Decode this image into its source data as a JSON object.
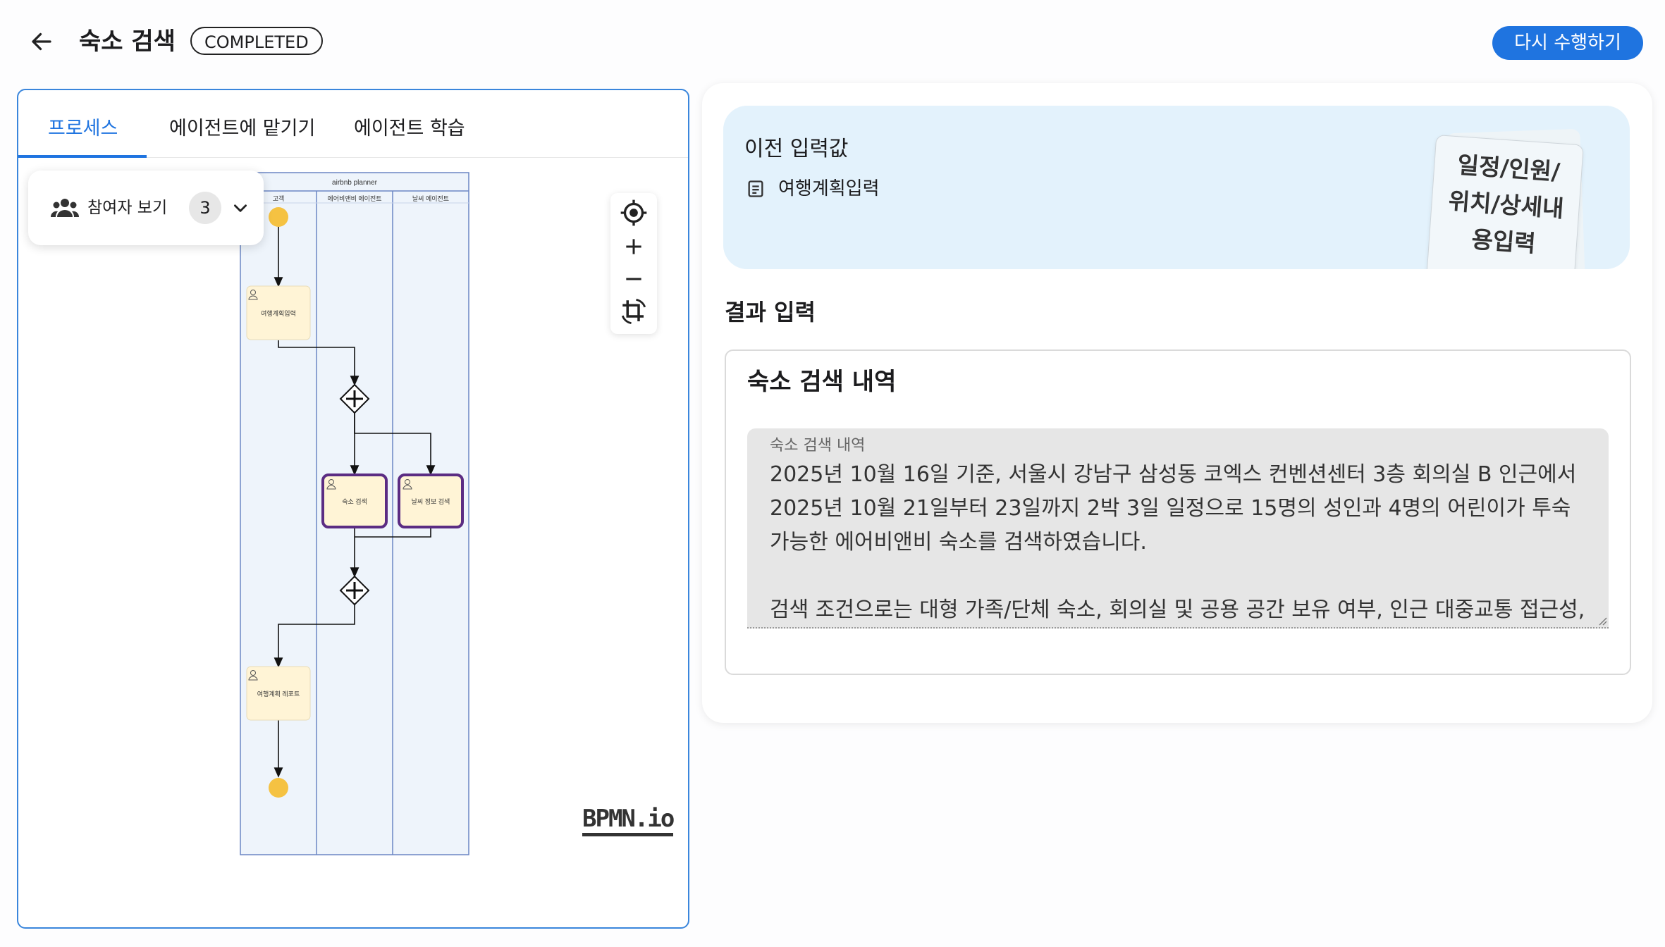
{
  "header": {
    "title": "숙소 검색",
    "status": "COMPLETED",
    "redo_label": "다시 수행하기"
  },
  "tabs": [
    {
      "label": "프로세스",
      "active": true
    },
    {
      "label": "에이전트에 맡기기",
      "active": false
    },
    {
      "label": "에이전트 학습",
      "active": false
    }
  ],
  "participants": {
    "label": "참여자 보기",
    "count": "3"
  },
  "diagram": {
    "pool_title": "airbnb planner",
    "lanes": [
      "고객",
      "에어비앤비 에이전트",
      "날씨 에이전트"
    ],
    "tasks": [
      "여행계획입력",
      "숙소 검색",
      "날씨 정보 검색",
      "여행계획 레포트"
    ],
    "logo": "BPMN.io"
  },
  "previous": {
    "title": "이전 입력값",
    "item": "여행계획입력",
    "note": "일정/인원/위치/상세내용입력"
  },
  "result": {
    "title": "결과 입력",
    "field_title": "숙소 검색 내역",
    "field_label": "숙소 검색 내역",
    "field_value": "2025년 10월 16일 기준, 서울시 강남구 삼성동 코엑스 컨벤션센터 3층 회의실 B 인근에서 2025년 10월 21일부터 23일까지 2박 3일 일정으로 15명의 성인과 4명의 어린이가 투숙 가능한 에어비앤비 숙소를 검색하였습니다.\n\n검색 조건으로는 대형 가족/단체 숙소, 회의실 및 공용 공간 보유 여부, 인근 대중교통 접근성, 조"
  },
  "colors": {
    "accent": "#1f74e0",
    "task_fill": "#fff4d6",
    "task_active_border": "#5b2c83",
    "event_fill": "#f5c242",
    "lane_fill": "#eef4fb",
    "lane_border": "#6b86c4"
  }
}
